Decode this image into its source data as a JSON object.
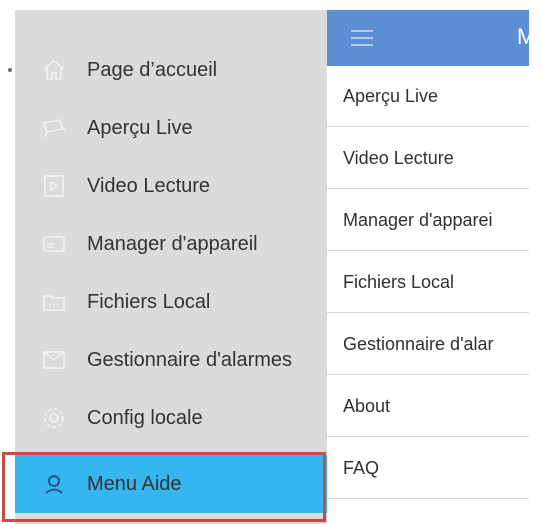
{
  "drawer": {
    "items": [
      {
        "label": "Page d’accueil",
        "icon": "home-icon"
      },
      {
        "label": "Aperçu Live",
        "icon": "camera-icon"
      },
      {
        "label": "Video Lecture",
        "icon": "video-file-icon"
      },
      {
        "label": "Manager d'appareil",
        "icon": "device-icon"
      },
      {
        "label": "Fichiers Local",
        "icon": "folder-icon"
      },
      {
        "label": "Gestionnaire d'alarmes",
        "icon": "alarm-mail-icon"
      },
      {
        "label": "Config locale",
        "icon": "gear-icon"
      },
      {
        "label": "Menu Aide",
        "icon": "help-user-icon"
      }
    ],
    "active_index": 7,
    "active_color": "#35b6ef",
    "highlight_outline_color": "#c84a4a"
  },
  "main": {
    "header": {
      "title": "M",
      "color": "#5b8fd2"
    },
    "menu": [
      "Aperçu Live",
      "Video Lecture",
      "Manager d'apparei",
      "Fichiers Local",
      "Gestionnaire d'alar",
      "About",
      "FAQ"
    ]
  }
}
